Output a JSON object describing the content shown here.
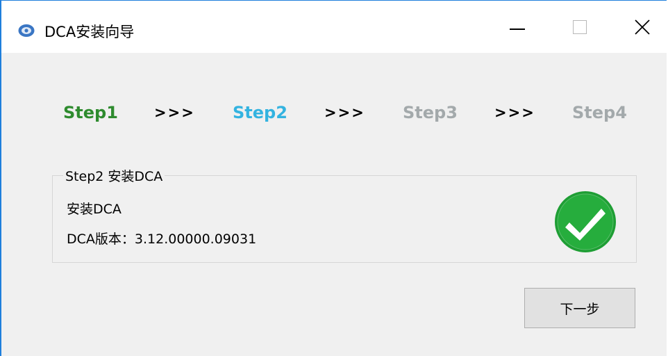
{
  "window": {
    "title": "DCA安装向导"
  },
  "title_bar": {
    "minimize_icon": "minimize-icon",
    "maximize_icon": "maximize-icon",
    "close_icon": "close-icon"
  },
  "steps": [
    {
      "label": "Step1",
      "color": "#2e8b2e"
    },
    {
      "label": "Step2",
      "color": "#33b3e0"
    },
    {
      "label": "Step3",
      "color": "#a3a9ab"
    },
    {
      "label": "Step4",
      "color": "#a3a9ab"
    }
  ],
  "step_separator": ">>>",
  "group": {
    "title": "Step2 安装DCA",
    "line1": "安装DCA",
    "line2": "DCA版本：3.12.00000.09031",
    "status_icon": "check-circle-icon"
  },
  "buttons": {
    "next_label": "下一步"
  },
  "colors": {
    "accent_border": "#1f7fdc",
    "success_green": "#22a83a",
    "window_bg": "#f0f0f0"
  }
}
